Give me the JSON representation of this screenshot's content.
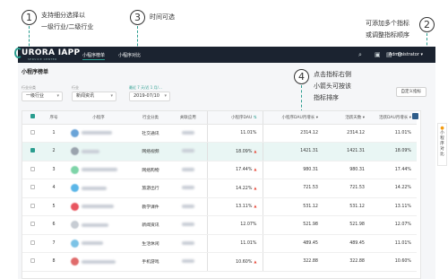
{
  "annotations": [
    {
      "num": "1",
      "lines": [
        "支持细分选择以",
        "一级行业/二级行业"
      ]
    },
    {
      "num": "3",
      "lines": [
        "时间可选"
      ]
    },
    {
      "num": "2",
      "lines": [
        "可添加多个指标",
        "或调整指标顺序"
      ]
    },
    {
      "num": "4",
      "lines": [
        "点击指标右侧",
        "小箭头可按该",
        "指标排序"
      ]
    }
  ],
  "topbar": {
    "logo": "URORA IAPP",
    "logo_sub": "SERVICE CENTER",
    "nav": [
      "小程序榜单",
      "小程序对比"
    ],
    "admin": "Administrator"
  },
  "page_title": "小程序榜单",
  "filters": {
    "industry": {
      "label": "行业分类",
      "value": "一级行业"
    },
    "sub": {
      "label": "行业",
      "value": "新闻资讯"
    },
    "date": {
      "label": "最近 7 天/近 1 月/…",
      "value": "2019-07/10"
    }
  },
  "custom_button": "自定义指标",
  "table": {
    "headers": [
      "序号",
      "小程序",
      "行业分类",
      "关联应用",
      "小程序DAU",
      "小程序DAU月增长",
      "活跃天数",
      "活跃DAU月增长"
    ],
    "rows": [
      {
        "idx": "1",
        "cat": "社交通讯",
        "dau": "11.01%",
        "dau_up": false,
        "dau_growth": "2314.12",
        "days": "2314.12",
        "act": "11.01%",
        "sel": false,
        "color": "#6aa4d8"
      },
      {
        "idx": "2",
        "cat": "网络视频",
        "dau": "18.09%",
        "dau_up": true,
        "dau_growth": "1421.31",
        "days": "1421.31",
        "act": "18.09%",
        "sel": true,
        "color": "#9aa3ad"
      },
      {
        "idx": "3",
        "cat": "网络购物",
        "dau": "17.44%",
        "dau_up": true,
        "dau_growth": "980.31",
        "days": "980.31",
        "act": "17.44%",
        "sel": false,
        "color": "#7ed4a8"
      },
      {
        "idx": "4",
        "cat": "旅游出行",
        "dau": "14.22%",
        "dau_up": true,
        "dau_growth": "721.53",
        "days": "721.53",
        "act": "14.22%",
        "sel": false,
        "color": "#5bb6e8"
      },
      {
        "idx": "5",
        "cat": "教学课件",
        "dau": "13.11%",
        "dau_up": true,
        "dau_growth": "531.12",
        "days": "531.12",
        "act": "13.11%",
        "sel": false,
        "color": "#e8555f"
      },
      {
        "idx": "6",
        "cat": "新闻资讯",
        "dau": "12.07%",
        "dau_up": false,
        "dau_growth": "521.98",
        "days": "521.98",
        "act": "12.07%",
        "sel": false,
        "color": "#c7ccd3"
      },
      {
        "idx": "7",
        "cat": "生活休闲",
        "dau": "11.01%",
        "dau_up": false,
        "dau_growth": "489.45",
        "days": "489.45",
        "act": "11.01%",
        "sel": false,
        "color": "#7cc3e6"
      },
      {
        "idx": "8",
        "cat": "手机游戏",
        "dau": "10.60%",
        "dau_up": true,
        "dau_growth": "322.88",
        "days": "322.88",
        "act": "10.60%",
        "sel": false,
        "color": "#e06b6b"
      }
    ]
  },
  "side_tab": "小程序对比",
  "colors": {
    "accent": "#2a9d8f",
    "topbar": "#1b2330",
    "up_arrow": "#e74c3c"
  }
}
